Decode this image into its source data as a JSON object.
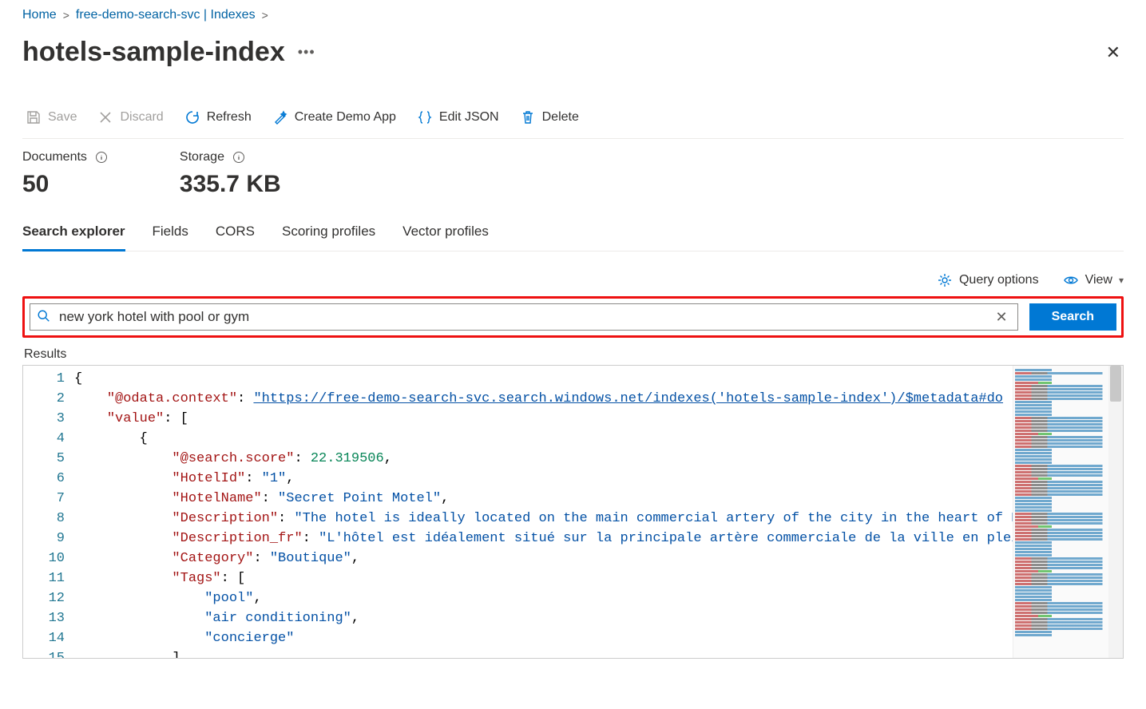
{
  "breadcrumb": {
    "home": "Home",
    "service": "free-demo-search-svc | Indexes"
  },
  "title": "hotels-sample-index",
  "toolbar": {
    "save": "Save",
    "discard": "Discard",
    "refresh": "Refresh",
    "create_demo": "Create Demo App",
    "edit_json": "Edit JSON",
    "delete": "Delete"
  },
  "stats": {
    "documents_label": "Documents",
    "documents_value": "50",
    "storage_label": "Storage",
    "storage_value": "335.7 KB"
  },
  "tabs": {
    "search_explorer": "Search explorer",
    "fields": "Fields",
    "cors": "CORS",
    "scoring": "Scoring profiles",
    "vector": "Vector profiles"
  },
  "options": {
    "query_options": "Query options",
    "view": "View"
  },
  "search": {
    "value": "new york hotel with pool or gym",
    "button": "Search"
  },
  "results_label": "Results",
  "json": {
    "context_key": "\"@odata.context\"",
    "context_val": "\"https://free-demo-search-svc.search.windows.net/indexes('hotels-sample-index')/$metadata#do",
    "value_key": "\"value\"",
    "score_key": "\"@search.score\"",
    "score_val": "22.319506",
    "hotelid_key": "\"HotelId\"",
    "hotelid_val": "\"1\"",
    "hotelname_key": "\"HotelName\"",
    "hotelname_val": "\"Secret Point Motel\"",
    "desc_key": "\"Description\"",
    "desc_val": "\"The hotel is ideally located on the main commercial artery of the city in the heart of New",
    "descfr_key": "\"Description_fr\"",
    "descfr_val": "\"L'hôtel est idéalement situé sur la principale artère commerciale de la ville en plein",
    "category_key": "\"Category\"",
    "category_val": "\"Boutique\"",
    "tags_key": "\"Tags\"",
    "tag1": "\"pool\"",
    "tag2": "\"air conditioning\"",
    "tag3": "\"concierge\""
  }
}
